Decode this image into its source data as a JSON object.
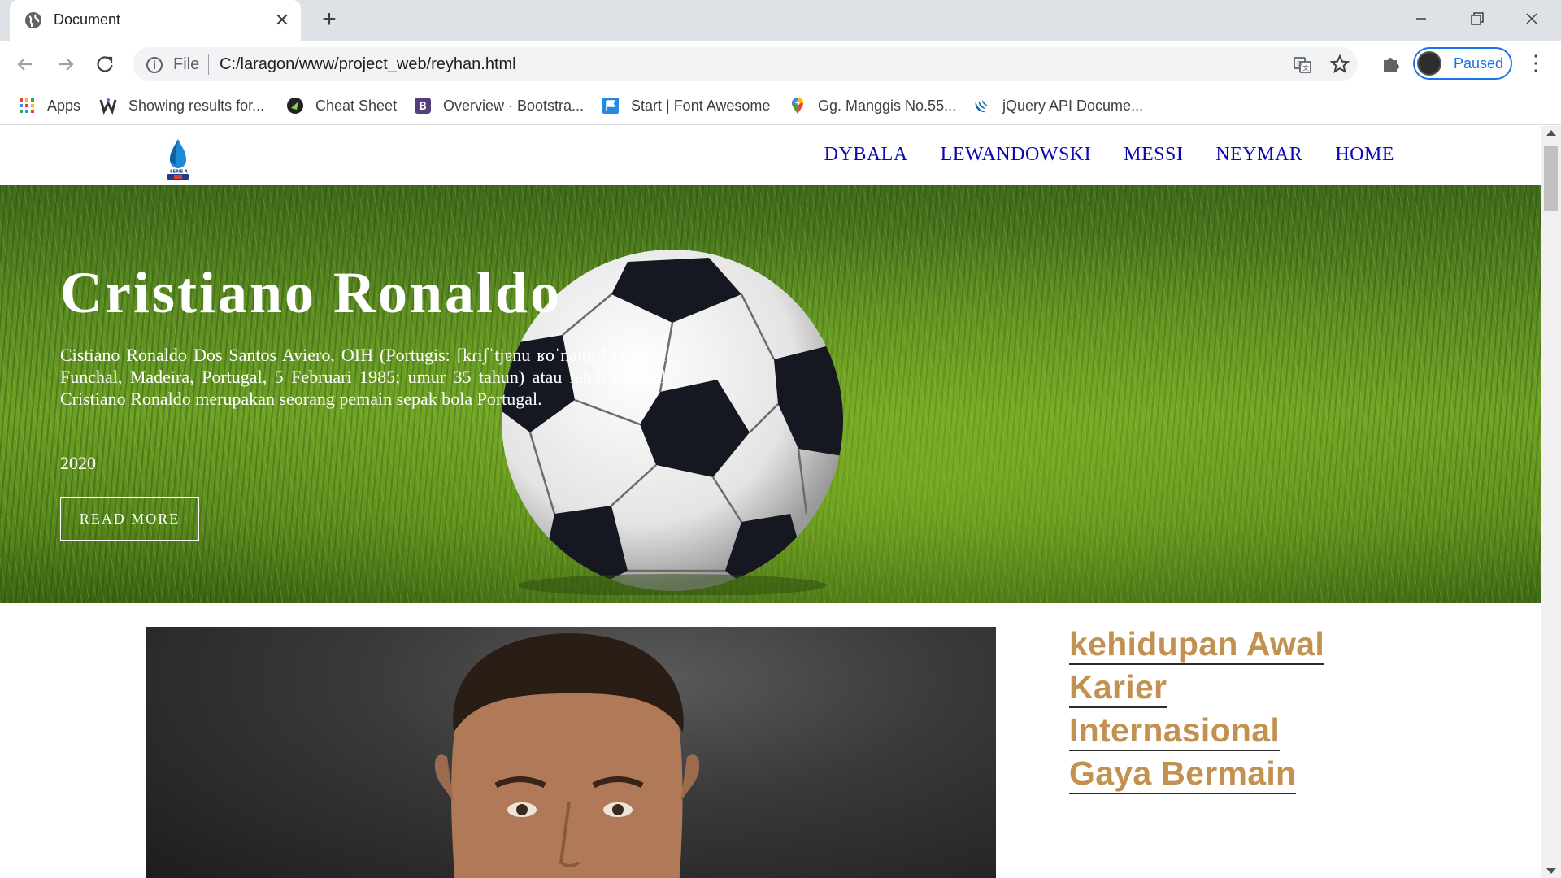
{
  "browser": {
    "tab_title": "Document",
    "tab_close": "✕",
    "new_tab": "+",
    "omnibox_scheme": "File",
    "url": "C:/laragon/www/project_web/reyhan.html",
    "profile_label": "Paused",
    "menu": "⋮"
  },
  "bookmarks": [
    {
      "label": "Apps",
      "icon": "apps-grid-icon"
    },
    {
      "label": "Showing results for...",
      "icon": "w-logo-icon"
    },
    {
      "label": "Cheat Sheet",
      "icon": "cheat-sheet-icon"
    },
    {
      "label": "Overview · Bootstra...",
      "icon": "bootstrap-icon"
    },
    {
      "label": "Start | Font Awesome",
      "icon": "font-awesome-flag-icon"
    },
    {
      "label": "Gg. Manggis No.55...",
      "icon": "maps-pin-icon"
    },
    {
      "label": "jQuery API Docume...",
      "icon": "jquery-icon"
    }
  ],
  "site": {
    "nav": [
      "DYBALA",
      "LEWANDOWSKI",
      "MESSI",
      "NEYMAR",
      "HOME"
    ],
    "hero": {
      "title": "Cristiano Ronaldo",
      "text": "Cistiano Ronaldo Dos Santos Aviero, OIH (Portugis: [kɾiʃˈtjɐnu ʁoˈnaɫdu] lahir di Funchal, Madeira, Portugal, 5 Februari 1985; umur 35 tahun) atau lebih dikenal Cristiano Ronaldo merupakan seorang pemain sepak bola Portugal.",
      "year": "2020",
      "button": "READ MORE"
    },
    "side_links": [
      "kehidupan Awal",
      "Karier",
      "Internasional",
      "Gaya Bermain"
    ]
  },
  "colors": {
    "nav_link": "#0a0ab4",
    "side_link": "#c29150",
    "profile_accent": "#1a73e8"
  }
}
